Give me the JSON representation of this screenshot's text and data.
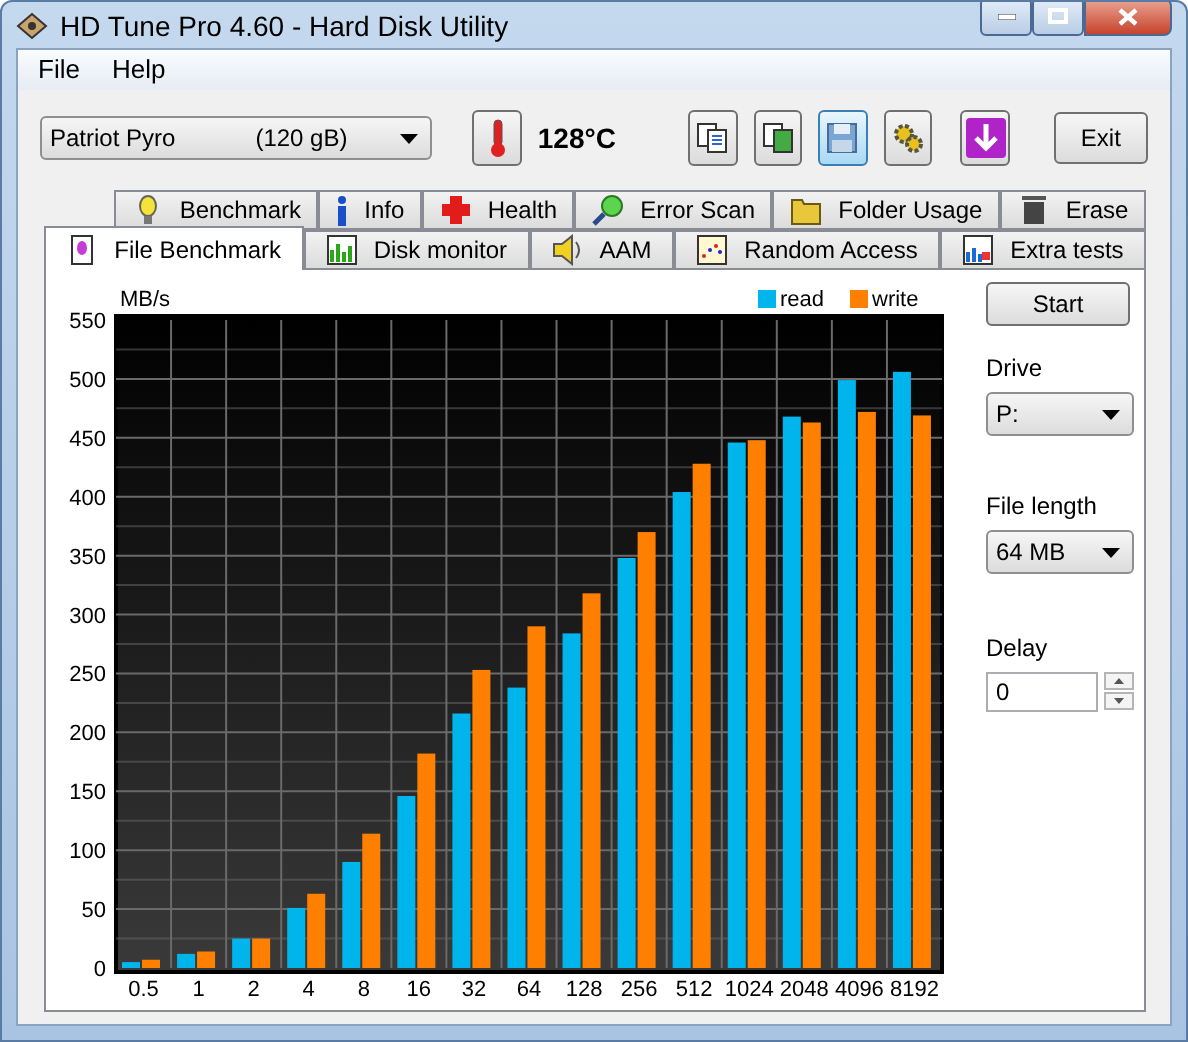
{
  "window": {
    "title": "HD Tune Pro 4.60 - Hard Disk Utility"
  },
  "menu": [
    {
      "label": "File"
    },
    {
      "label": "Help"
    }
  ],
  "toolbar": {
    "drive": {
      "name": "Patriot Pyro",
      "capacity": "(120 gB)"
    },
    "temperature": "128°C",
    "exit": "Exit"
  },
  "tabs": [
    [
      {
        "label": "Benchmark",
        "selected": false
      },
      {
        "label": "Info",
        "selected": false
      },
      {
        "label": "Health",
        "selected": false
      },
      {
        "label": "Error Scan",
        "selected": false
      },
      {
        "label": "Folder Usage",
        "selected": false
      },
      {
        "label": "Erase",
        "selected": false
      }
    ],
    [
      {
        "label": "File Benchmark",
        "selected": true
      },
      {
        "label": "Disk monitor",
        "selected": false
      },
      {
        "label": "AAM",
        "selected": false
      },
      {
        "label": "Random Access",
        "selected": false
      },
      {
        "label": "Extra tests",
        "selected": false
      }
    ]
  ],
  "panel": {
    "start": "Start",
    "drive_label": "Drive",
    "drive_value": "P:",
    "file_length_label": "File length",
    "file_length_value": "64 MB",
    "delay_label": "Delay",
    "delay_value": "0",
    "chart_data": {
      "type": "bar",
      "ylabel": "MB/s",
      "categories": [
        "0.5",
        "1",
        "2",
        "4",
        "8",
        "16",
        "32",
        "64",
        "128",
        "256",
        "512",
        "1024",
        "2048",
        "4096",
        "8192"
      ],
      "series": [
        {
          "name": "read",
          "color": "#00b4ec",
          "values": [
            5,
            12,
            25,
            51,
            90,
            146,
            216,
            238,
            284,
            348,
            404,
            446,
            468,
            499,
            506
          ]
        },
        {
          "name": "write",
          "color": "#ff8000",
          "values": [
            7,
            14,
            25,
            63,
            114,
            182,
            253,
            290,
            318,
            370,
            428,
            448,
            463,
            472,
            469
          ]
        }
      ],
      "grid": true,
      "legend": "top-right",
      "ylim": [
        0,
        550
      ],
      "yticks": [
        0,
        50,
        100,
        150,
        200,
        250,
        300,
        350,
        400,
        450,
        500,
        550
      ]
    }
  }
}
